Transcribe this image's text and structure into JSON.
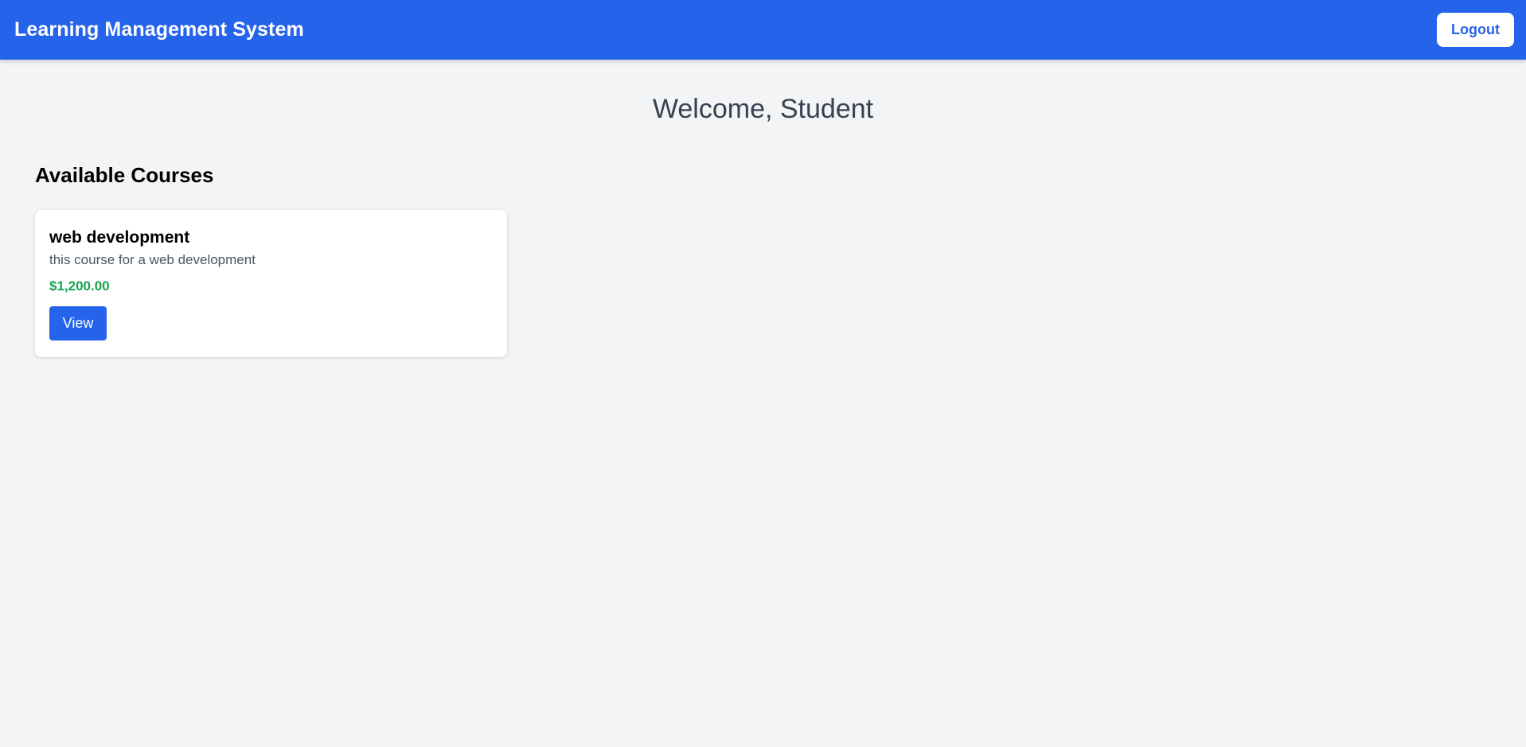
{
  "header": {
    "title": "Learning Management System",
    "logout_label": "Logout"
  },
  "main": {
    "welcome": "Welcome, Student",
    "section_title": "Available Courses",
    "courses": [
      {
        "title": "web development",
        "description": "this course for a web development",
        "price": "$1,200.00",
        "view_label": "View"
      }
    ]
  },
  "colors": {
    "header_bg": "#2563eb",
    "page_bg": "#f3f4f6",
    "price": "#16a34a",
    "primary_button": "#2563eb"
  }
}
